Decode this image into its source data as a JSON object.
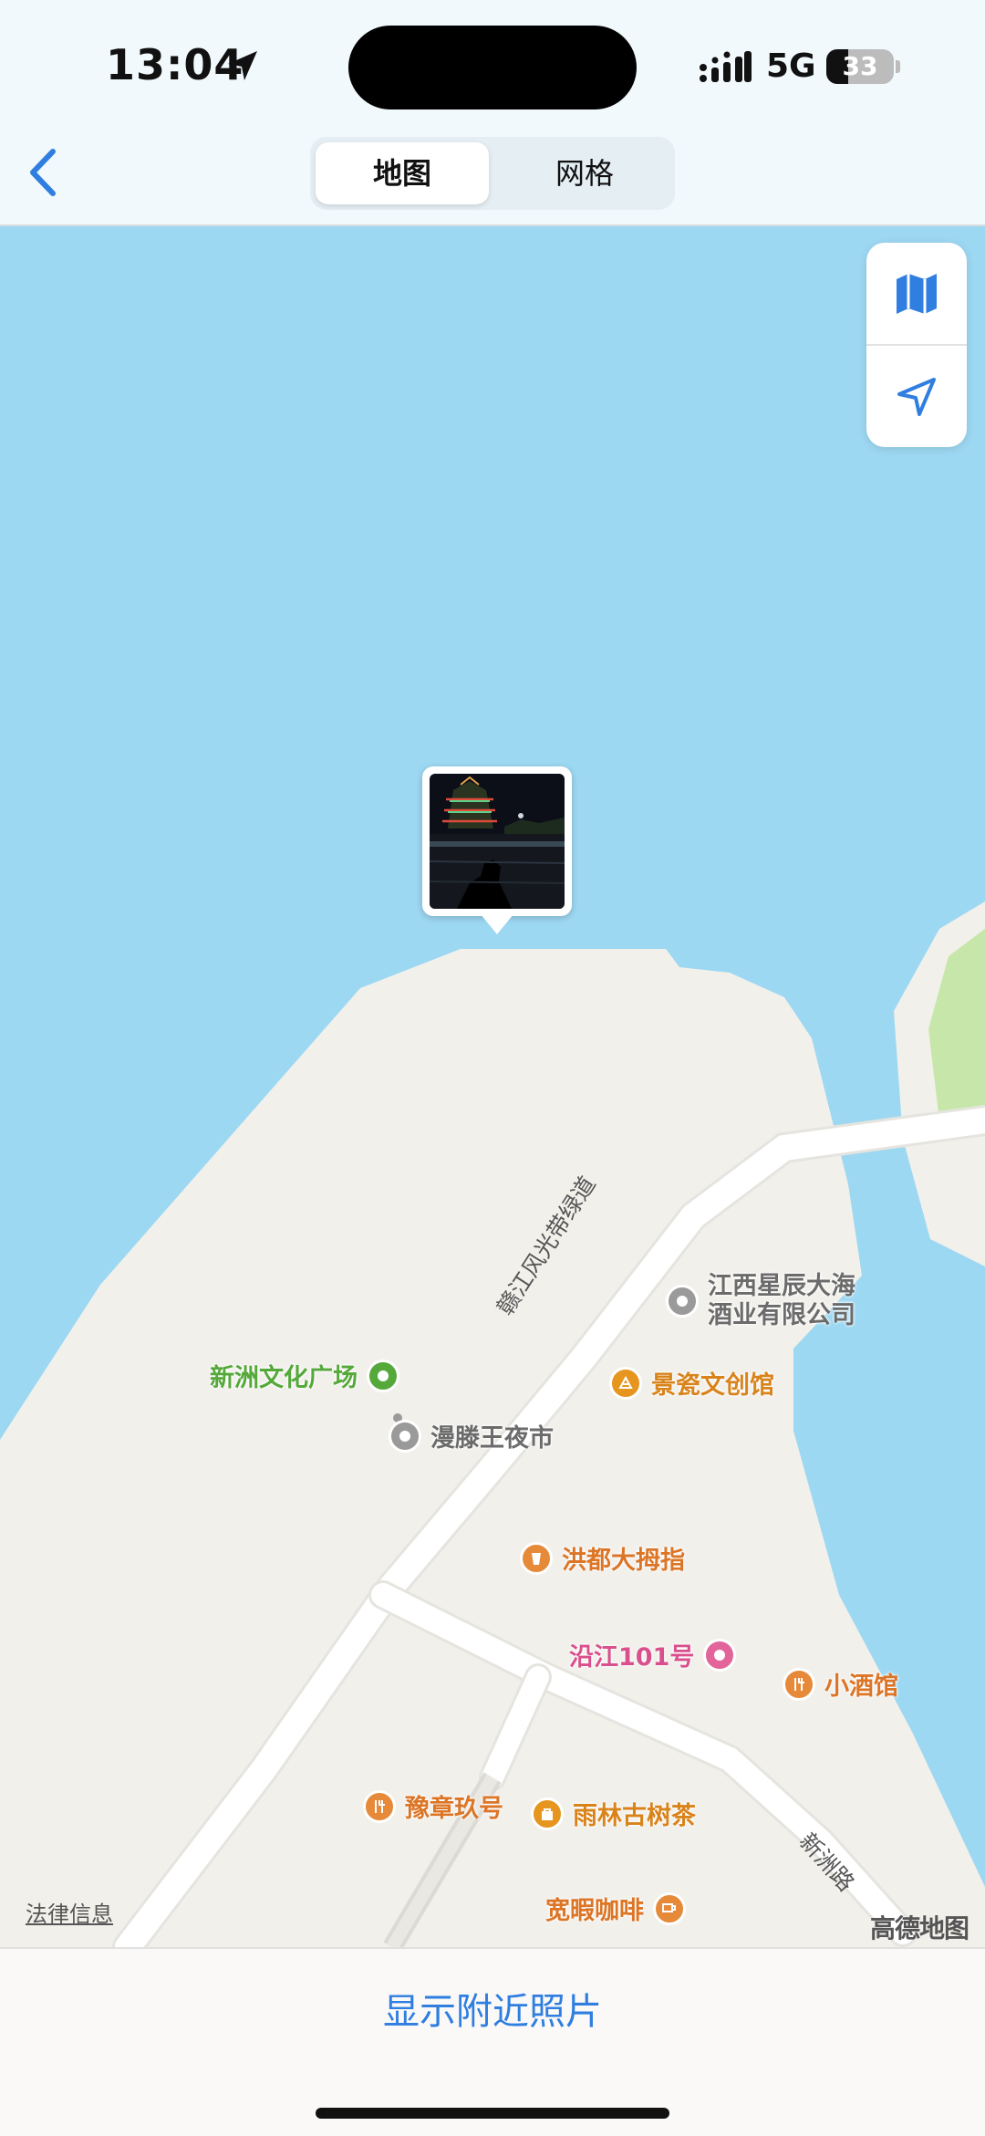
{
  "status_bar": {
    "time": "13:04",
    "network": "5G",
    "battery_level": "33",
    "battery_fraction": 0.33
  },
  "header": {
    "back_icon": "chevron-left-icon",
    "tabs": [
      {
        "label": "地图",
        "selected": true
      },
      {
        "label": "网格",
        "selected": false
      }
    ]
  },
  "map_controls": [
    {
      "icon": "map-icon"
    },
    {
      "icon": "location-arrow-icon"
    }
  ],
  "pois": [
    {
      "name": "新洲文化广场",
      "color": "#55a83a"
    },
    {
      "name": "漫滕王夜市",
      "color": "#9a9a9a"
    },
    {
      "name_line1": "江西星辰大海",
      "name_line2": "酒业有限公司",
      "color": "#9a9a9a"
    },
    {
      "name": "景瓷文创馆",
      "color": "#e6951f"
    },
    {
      "name": "洪都大拇指",
      "color": "#e68a3a"
    },
    {
      "name": "沿江101号",
      "color": "#e3639b"
    },
    {
      "name": "小酒馆",
      "color": "#e68a3a"
    },
    {
      "name": "豫章玖号",
      "color": "#e68a3a"
    },
    {
      "name": "雨林古树茶",
      "color": "#e6951f"
    },
    {
      "name": "宽暇咖啡",
      "color": "#e68a3a"
    }
  ],
  "roads": {
    "greenway": "赣江风光带绿道",
    "xinzhou_road": "新洲路"
  },
  "map_footer": {
    "legal": "法律信息",
    "provider": "高德地图"
  },
  "bottom": {
    "action": "显示附近照片"
  },
  "colors": {
    "water": "#9dd8f2",
    "land": "#f2f0eb",
    "park": "#c6e7a9",
    "road": "#ffffff",
    "accent": "#2f7ee0"
  }
}
